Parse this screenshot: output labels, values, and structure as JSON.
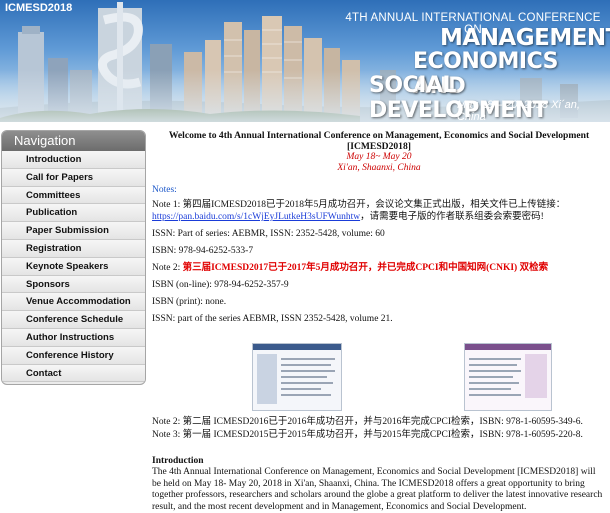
{
  "banner": {
    "acronym": "ICMESD2018",
    "annual_line": "4TH ANNUAL INTERNATIONAL CONFERENCE ON",
    "title_line1": "MANAGEMENT,",
    "title_line2": "ECONOMICS AND",
    "title_line3": "SOCIAL DEVELOPMENT",
    "date_line": "May 18 – 20, 2018 Xi´an, China"
  },
  "nav": {
    "header": "Navigation",
    "items": [
      "Introduction",
      "Call for Papers",
      "Committees",
      "Publication",
      "Paper Submission",
      "Registration",
      "Keynote Speakers",
      "Sponsors",
      "Venue Accommodation",
      "Conference Schedule",
      "Author Instructions",
      "Conference History",
      "Contact"
    ]
  },
  "main": {
    "welcome_title": "Welcome to 4th Annual International Conference on Management, Economics and Social Development [ICMESD2018]",
    "dates": "May 18~ May 20",
    "location": "Xi'an, Shaanxi, China",
    "notes_label": "Notes:",
    "note1_text": "Note 1: 第四届ICMESD2018已于2018年5月成功召开，会议论文集正式出版，相关文件已上传链接：",
    "note1_link": "https://pan.baidu.com/s/1cWjEyJLutkeH3sUFWunhtw",
    "note1_suffix": "，请需要电子版的作者联系组委会索要密码!",
    "issn1": "ISSN: Part of series: AEBMR, ISSN: 2352-5428, volume: 60",
    "isbn1": "ISBN: 978-94-6252-533-7",
    "note2_prefix": "Note 2: ",
    "note2_red": "第三届ICMESD2017已于2017年5月成功召开，并已完成CPCI和中国知网(CNKI) 双检索",
    "isbn_online": "ISBN (on-line): 978-94-6252-357-9",
    "isbn_print": "ISBN (print): none.",
    "issn2": "ISSN: part of the series AEBMR, ISSN 2352-5428, volume 21.",
    "note2b": "Note 2: 第二届 ICMESD2016已于2016年成功召开，并与2016年完成CPCI检索，ISBN: 978-1-60595-349-6.",
    "note3": "Note 3: 第一届 ICMESD2015已于2015年成功召开，并与2015年完成CPCI检索，ISBN: 978-1-60595-220-8.",
    "intro_title": "Introduction",
    "intro_text": "The 4th Annual International Conference on Management, Economics and Social Development [ICMESD2018] will be held on May 18- May 20, 2018 in Xi'an, Shaanxi, China. The ICMESD2018 offers a great opportunity to bring together professors, researchers and scholars around the globe a great platform to deliver the latest innovative research result, and the most recent development and in Management, Economics and Social Development."
  }
}
